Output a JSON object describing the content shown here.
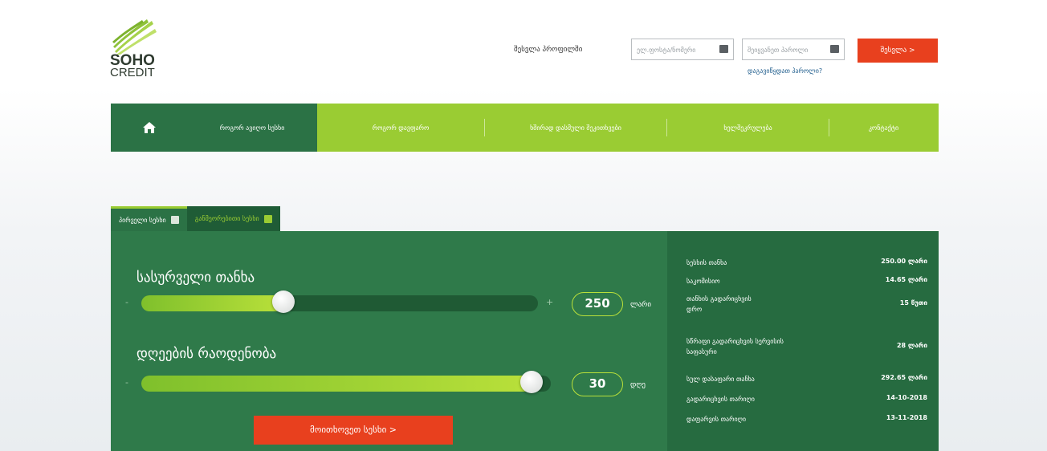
{
  "brand": {
    "line1": "SOHO",
    "line2": "CREDIT"
  },
  "login": {
    "label": "შესვლა პროფილში",
    "username_placeholder": "ელ.ფოსტა/ნომერი",
    "password_placeholder": "შეიყვანეთ პაროლი",
    "enter_label": "შესვლა >",
    "forgot_label": "დაგავიწყდათ პაროლი?"
  },
  "nav": {
    "items": [
      "როგორ ავიღო სესხი",
      "როგორ დავფარო",
      "ხშირად დასმული შეკითხვები",
      "ხელშეკრულება",
      "კონტაქტი"
    ]
  },
  "tabs": [
    "პირველი სესხი",
    "განმეორებითი სესხი"
  ],
  "calculator": {
    "amount_title": "სასურველი თანხა",
    "amount_value": "250",
    "amount_unit": "ლარი",
    "amount_level": 0.35,
    "days_title": "დღეების რაოდენობა",
    "days_value": "30",
    "days_unit": "დღე",
    "days_level": 0.98,
    "minus": "-",
    "plus": "+",
    "cta_label": "მოითხოვეთ სესხი >"
  },
  "summary": [
    {
      "key": "სესხის თანხა",
      "value": "250.00 ლარი"
    },
    {
      "key": "საკომისიო",
      "value": "14.65 ლარი"
    },
    {
      "key": "თანხის გადარიცხვის დრო",
      "value": "15 წუთი"
    },
    {
      "key": "სწრაფი გადარიცხვის სერვისის საფასური",
      "value": "28 ლარი"
    },
    {
      "key": "სულ დასაფარი თანხა",
      "value": "292.65 ლარი"
    },
    {
      "key": "გადარიცხვის თარიღი",
      "value": "14-10-2018"
    },
    {
      "key": "დაფარვის თარიღი",
      "value": "13-11-2018"
    }
  ],
  "icons": {
    "home": "home-icon",
    "tab": "bank-icon",
    "keyboard": "keyboard-icon"
  },
  "colors": {
    "green_dark": "#2b7245",
    "green_light": "#9acc33",
    "accent_red": "#e8401e"
  }
}
